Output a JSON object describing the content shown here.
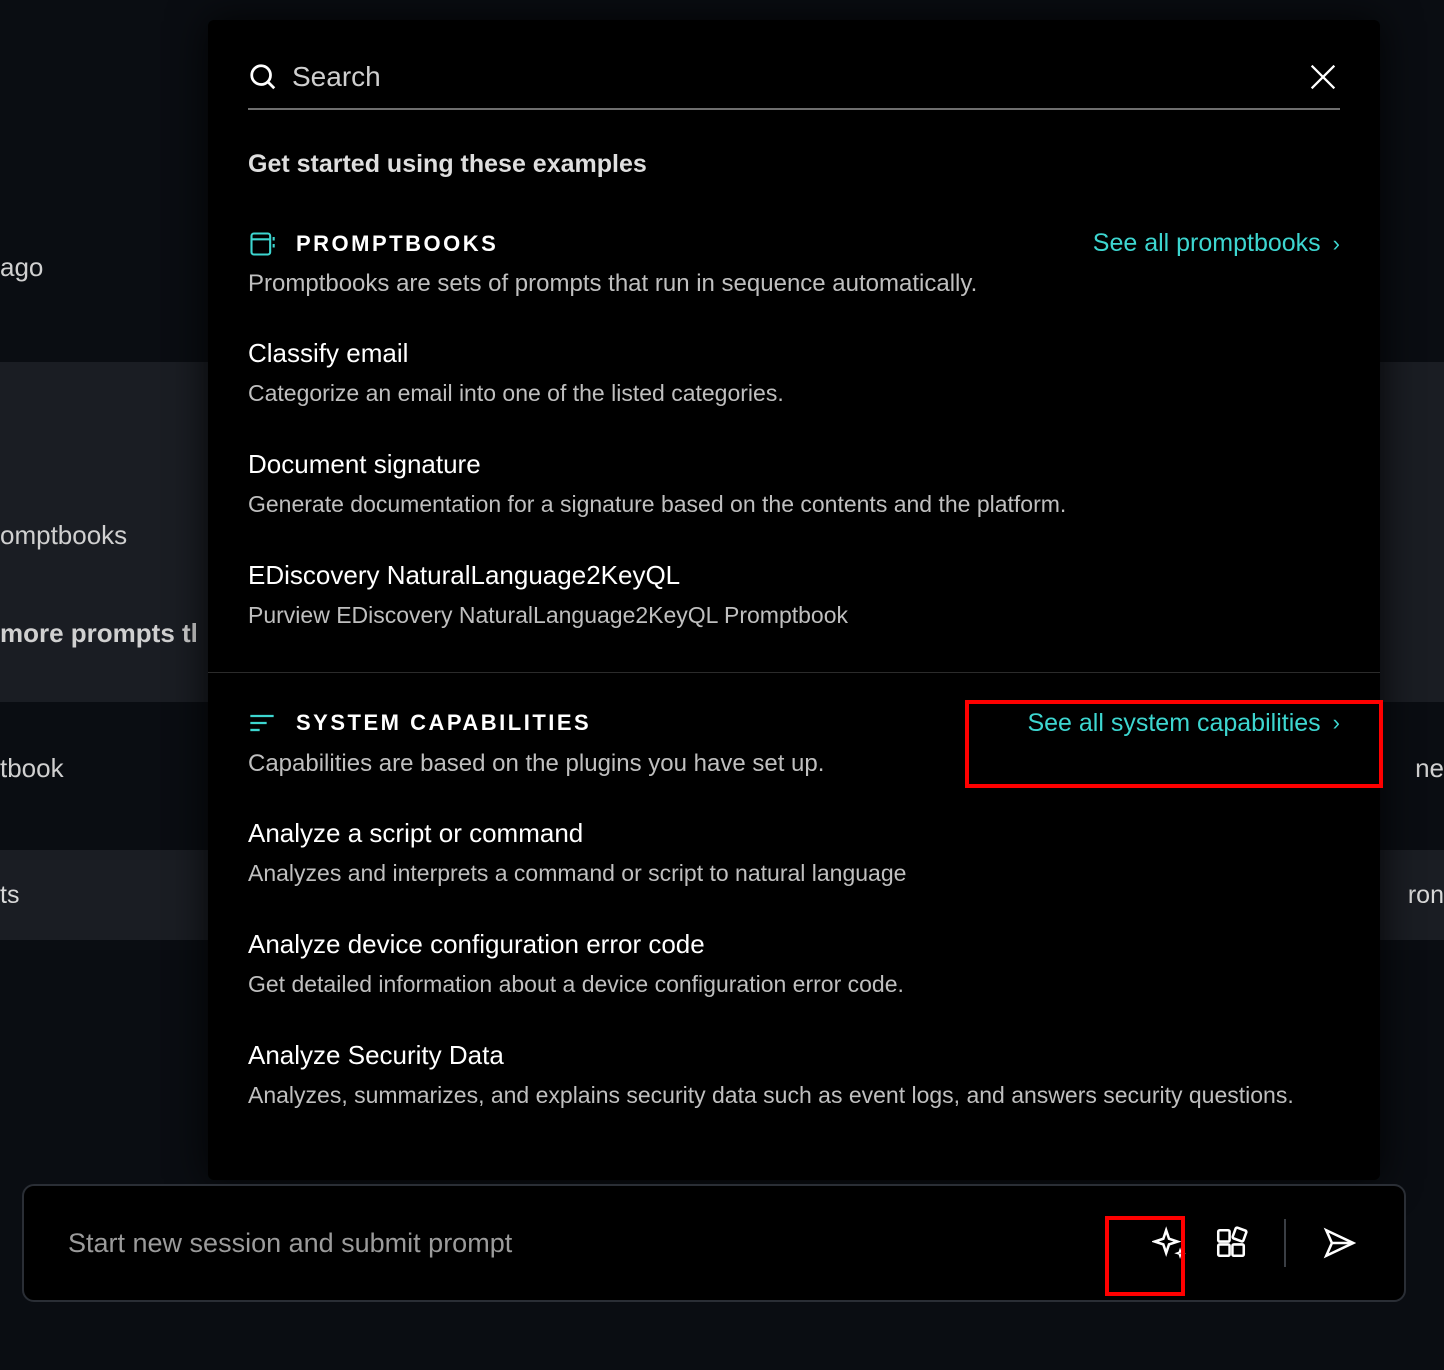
{
  "background": {
    "ago": "ago",
    "promptbooks": "omptbooks",
    "morePrompts": "more prompts tl",
    "tbook": "tbook",
    "ne": "ne",
    "ts": "ts",
    "ron": "ron"
  },
  "search": {
    "placeholder": "Search"
  },
  "introHeading": "Get started using these examples",
  "promptbooks": {
    "title": "PROMPTBOOKS",
    "seeAll": "See all promptbooks",
    "description": "Promptbooks are sets of prompts that run in sequence automatically.",
    "items": [
      {
        "title": "Classify email",
        "desc": "Categorize an email into one of the listed categories."
      },
      {
        "title": "Document signature",
        "desc": "Generate documentation for a signature based on the contents and the platform."
      },
      {
        "title": "EDiscovery NaturalLanguage2KeyQL",
        "desc": "Purview EDiscovery NaturalLanguage2KeyQL Promptbook"
      }
    ]
  },
  "systemCapabilities": {
    "title": "SYSTEM CAPABILITIES",
    "seeAll": "See all system capabilities",
    "description": "Capabilities are based on the plugins you have set up.",
    "items": [
      {
        "title": "Analyze a script or command",
        "desc": "Analyzes and interprets a command or script to natural language"
      },
      {
        "title": "Analyze device configuration error code",
        "desc": "Get detailed information about a device configuration error code."
      },
      {
        "title": "Analyze Security Data",
        "desc": "Analyzes, summarizes, and explains security data such as event logs, and answers security questions."
      }
    ]
  },
  "promptBar": {
    "placeholder": "Start new session and submit prompt"
  }
}
